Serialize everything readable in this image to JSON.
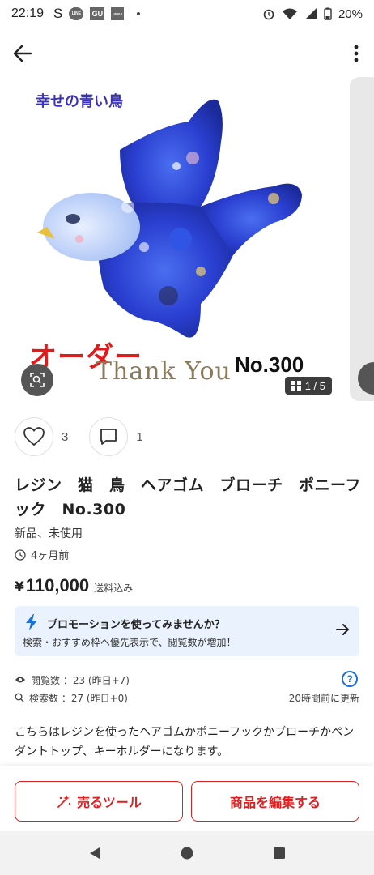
{
  "status_bar": {
    "time": "22:19",
    "app_icons": [
      "S",
      "LINE",
      "GU",
      "UNIQLO"
    ],
    "battery": "20%"
  },
  "gallery": {
    "photo_title": "幸せの青い鳥",
    "order_text": "オーダー",
    "thank_you": "Thank You",
    "product_no": "No.300",
    "counter": "1 / 5"
  },
  "actions": {
    "like_count": "3",
    "comment_count": "1"
  },
  "product": {
    "title": "レジン　猫　鳥　ヘアゴム　ブローチ　ポニーフック　No.300",
    "condition": "新品、未使用",
    "posted": "4ヶ月前",
    "price_symbol": "¥",
    "price": "110,000",
    "shipping": "送料込み"
  },
  "promo": {
    "title": "プロモーションを使ってみませんか？",
    "subtitle": "検索・おすすめ枠へ優先表示で、閲覧数が増加！"
  },
  "stats": {
    "views": "閲覧数 ：23 (昨日+7)",
    "searches": "検索数 ：27 (昨日+0)",
    "updated": "20時間前に更新",
    "help": "?"
  },
  "description": "こちらはレジンを使ったヘアゴムかポニーフックかブローチかペンダントトップ、キーホルダーになります。",
  "bottom": {
    "sell_tool": "売るツール",
    "edit_item": "商品を編集する"
  },
  "colors": {
    "accent": "#e02020",
    "promo_bg": "#eaf2fe",
    "link_blue": "#1e6fd9",
    "photo_title": "#3a31b9",
    "order_red": "#e21a1a"
  },
  "icons": [
    "back-arrow-icon",
    "more-vertical-icon",
    "zoom-icon",
    "gallery-grid-icon",
    "heart-icon",
    "comment-icon",
    "clock-icon",
    "bolt-icon",
    "arrow-right-icon",
    "eye-icon",
    "search-icon",
    "help-icon",
    "sparkle-icon",
    "nav-back-icon",
    "nav-home-icon",
    "nav-recents-icon"
  ]
}
